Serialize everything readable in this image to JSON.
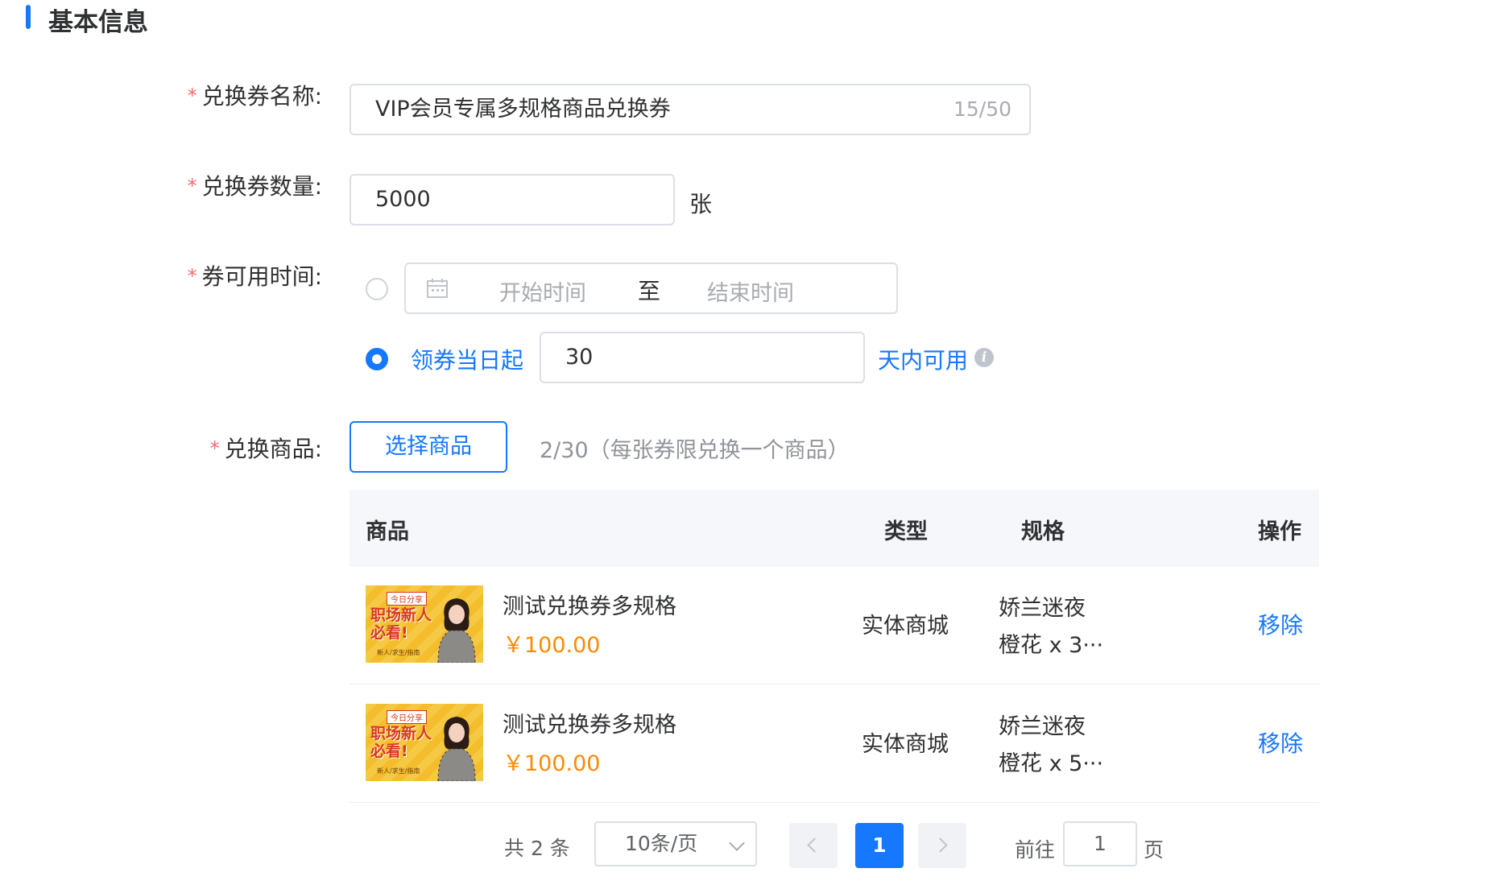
{
  "section": {
    "title": "基本信息"
  },
  "form": {
    "name": {
      "required": "*",
      "label": "兑换券名称:",
      "value": "VIP会员专属多规格商品兑换券",
      "counter": "15/50"
    },
    "quantity": {
      "required": "*",
      "label": "兑换券数量:",
      "value": "5000",
      "unit": "张"
    },
    "validity": {
      "required": "*",
      "label": "券可用时间:",
      "range": {
        "start_placeholder": "开始时间",
        "separator": "至",
        "end_placeholder": "结束时间"
      },
      "relative": {
        "label": "领券当日起",
        "value": "30",
        "suffix": "天内可用",
        "info": "i"
      },
      "selected": "relative"
    },
    "products": {
      "required": "*",
      "label": "兑换商品:",
      "button": "选择商品",
      "hint": "2/30（每张券限兑换一个商品）"
    }
  },
  "table": {
    "headers": {
      "product": "商品",
      "type": "类型",
      "spec": "规格",
      "action": "操作"
    },
    "rows": [
      {
        "thumb": {
          "badge": "今日分享",
          "line1": "职场新人",
          "line2": "必看!",
          "small": "新人/求生/指南"
        },
        "name": "测试兑换券多规格",
        "price": "￥100.00",
        "type": "实体商城",
        "spec1": "娇兰迷夜",
        "spec2": "橙花 x 3···",
        "action": "移除"
      },
      {
        "thumb": {
          "badge": "今日分享",
          "line1": "职场新人",
          "line2": "必看!",
          "small": "新人/求生/指南"
        },
        "name": "测试兑换券多规格",
        "price": "￥100.00",
        "type": "实体商城",
        "spec1": "娇兰迷夜",
        "spec2": "橙花 x 5···",
        "action": "移除"
      }
    ]
  },
  "pagination": {
    "total": "共 2 条",
    "page_size": "10条/页",
    "current": "1",
    "goto_prefix": "前往",
    "goto_value": "1",
    "goto_suffix": "页"
  },
  "colors": {
    "primary": "#1677ff",
    "required": "#f56c6c",
    "price": "#ff8a00"
  }
}
